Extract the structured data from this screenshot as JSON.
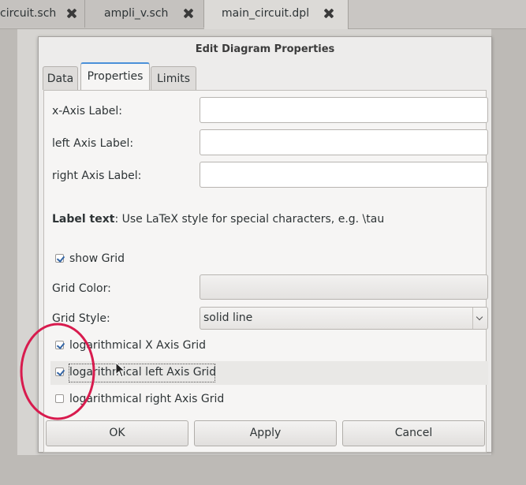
{
  "file_tabs": [
    {
      "label": "circuit.sch",
      "active": false
    },
    {
      "label": "ampli_v.sch",
      "active": false
    },
    {
      "label": "main_circuit.dpl",
      "active": true
    }
  ],
  "dialog": {
    "title": "Edit Diagram Properties",
    "tabs": [
      "Data",
      "Properties",
      "Limits"
    ],
    "active_tab": "Properties"
  },
  "fields": {
    "x_axis_label": "x-Axis Label:",
    "x_axis_value": "",
    "left_axis_label": "left Axis Label:",
    "left_axis_value": "",
    "right_axis_label": "right Axis Label:",
    "right_axis_value": ""
  },
  "hint": {
    "bold": "Label text",
    "text": ": Use LaTeX style for special characters, e.g. \\tau"
  },
  "grid": {
    "show_label": "show Grid",
    "show_checked": true,
    "color_label": "Grid Color:",
    "style_label": "Grid Style:",
    "style_value": "solid line"
  },
  "log_options": [
    {
      "label": "logarithmical X Axis Grid",
      "checked": true
    },
    {
      "label": "logarithmical left Axis Grid",
      "checked": true
    },
    {
      "label": "logarithmical right Axis Grid",
      "checked": false
    }
  ],
  "buttons": {
    "ok": "OK",
    "apply": "Apply",
    "cancel": "Cancel"
  },
  "colors": {
    "annotation": "#d81b4e",
    "active_tab_accent": "#4a90d9",
    "checkmark": "#3465a4"
  },
  "icons": [
    "close-icon",
    "dropdown-arrow-icon",
    "mouse-cursor-icon"
  ]
}
